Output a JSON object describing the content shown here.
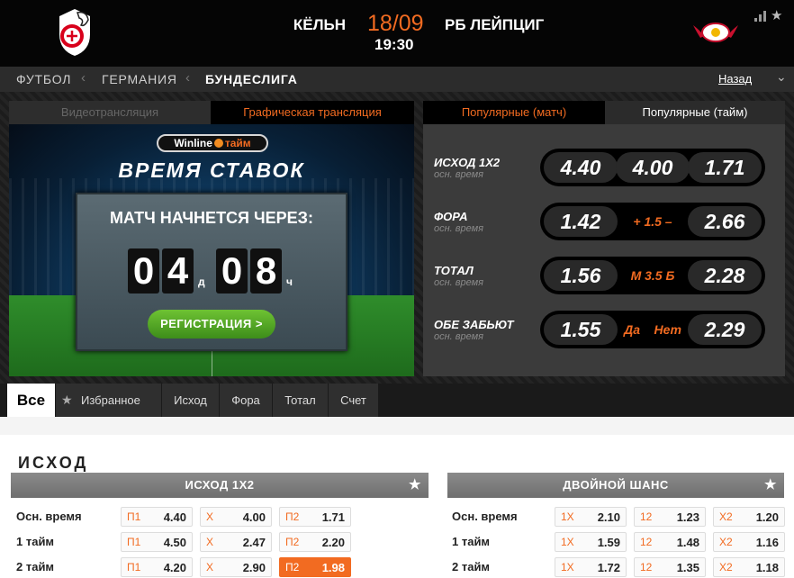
{
  "header": {
    "home_team": "КЁЛЬН",
    "away_team": "РБ ЛЕЙПЦИГ",
    "date": "18/09",
    "time": "19:30",
    "home_logo": "koln-logo",
    "away_logo": "rb-leipzig-logo",
    "accent_color": "#f26b21"
  },
  "breadcrumb": {
    "items": [
      "ФУТБОЛ",
      "ГЕРМАНИЯ",
      "БУНДЕСЛИГА"
    ],
    "back_label": "Назад"
  },
  "broadcast": {
    "tabs": [
      "Видеотрансляция",
      "Графическая трансляция"
    ],
    "winline_brand": "Winline",
    "winline_suffix": "тайм",
    "bet_time": "ВРЕМЯ СТАВОК",
    "match_starts_in": "МАТЧ НАЧНЕТСЯ ЧЕРЕЗ:",
    "days_digits": [
      "0",
      "4"
    ],
    "days_unit": "д",
    "hours_digits": [
      "0",
      "8"
    ],
    "hours_unit": "ч",
    "register_label": "РЕГИСТРАЦИЯ >"
  },
  "popular": {
    "tabs": [
      "Популярные (матч)",
      "Популярные (тайм)"
    ],
    "markets": [
      {
        "label": "ИСХОД 1Х2",
        "sub": "осн. время",
        "left": "4.40",
        "mid": "4.00",
        "right": "1.71"
      },
      {
        "label": "ФОРА",
        "sub": "осн. время",
        "left": "1.42",
        "mid": "+ 1.5 –",
        "right": "2.66"
      },
      {
        "label": "ТОТАЛ",
        "sub": "осн. время",
        "left": "1.56",
        "mid": "М 3.5 Б",
        "right": "2.28"
      },
      {
        "label": "ОБЕ ЗАБЬЮТ",
        "sub": "осн. время",
        "left": "1.55",
        "mid": "Да    Нет",
        "right": "2.29"
      }
    ]
  },
  "filters": [
    "Все",
    "Избранное",
    "Исход",
    "Фора",
    "Тотал",
    "Счет"
  ],
  "section": {
    "title": "ИСХОД",
    "tables": [
      {
        "title": "ИСХОД 1Х2",
        "rows": [
          {
            "label": "Осн. время",
            "odds": [
              {
                "k": "П1",
                "v": "4.40"
              },
              {
                "k": "Х",
                "v": "4.00"
              },
              {
                "k": "П2",
                "v": "1.71"
              }
            ]
          },
          {
            "label": "1 тайм",
            "odds": [
              {
                "k": "П1",
                "v": "4.50"
              },
              {
                "k": "Х",
                "v": "2.47"
              },
              {
                "k": "П2",
                "v": "2.20"
              }
            ]
          },
          {
            "label": "2 тайм",
            "odds": [
              {
                "k": "П1",
                "v": "4.20"
              },
              {
                "k": "Х",
                "v": "2.90"
              },
              {
                "k": "П2",
                "v": "1.98"
              }
            ]
          }
        ]
      },
      {
        "title": "ДВОЙНОЙ ШАНС",
        "rows": [
          {
            "label": "Осн. время",
            "odds": [
              {
                "k": "1Х",
                "v": "2.10"
              },
              {
                "k": "12",
                "v": "1.23"
              },
              {
                "k": "Х2",
                "v": "1.20"
              }
            ]
          },
          {
            "label": "1 тайм",
            "odds": [
              {
                "k": "1Х",
                "v": "1.59"
              },
              {
                "k": "12",
                "v": "1.48"
              },
              {
                "k": "Х2",
                "v": "1.16"
              }
            ]
          },
          {
            "label": "2 тайм",
            "odds": [
              {
                "k": "1Х",
                "v": "1.72"
              },
              {
                "k": "12",
                "v": "1.35"
              },
              {
                "k": "Х2",
                "v": "1.18"
              }
            ]
          }
        ]
      }
    ]
  }
}
